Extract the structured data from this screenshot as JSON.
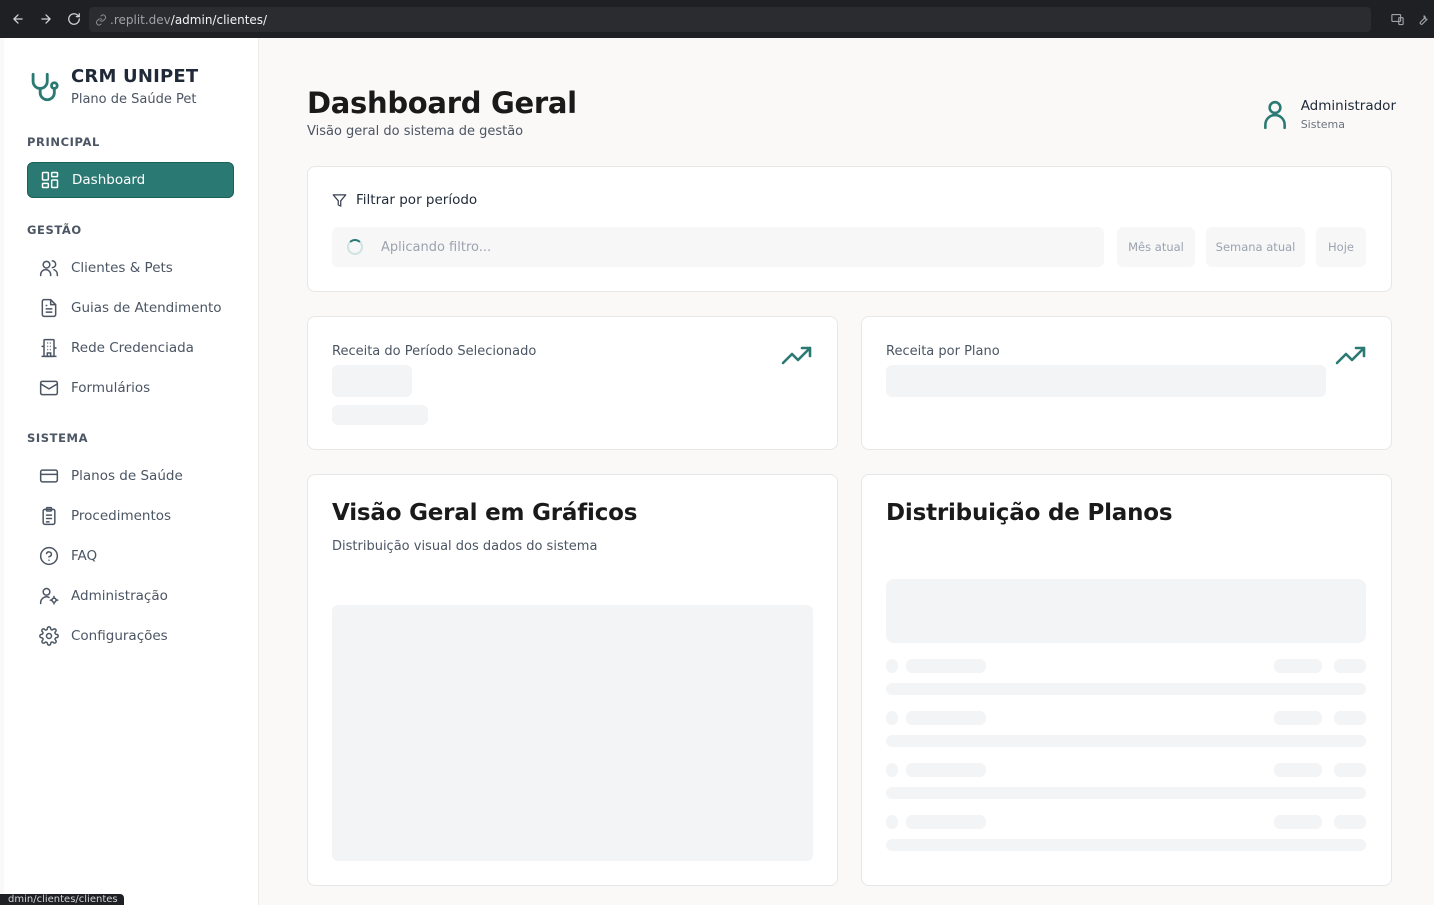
{
  "browser": {
    "url_host": ".replit.dev",
    "url_path": "/admin/clientes/",
    "status_link": "dmin/clientes/clientes"
  },
  "brand": {
    "title": "CRM UNIPET",
    "subtitle": "Plano de Saúde Pet"
  },
  "sidebar": {
    "sections": [
      {
        "label": "PRINCIPAL"
      },
      {
        "label": "GESTÃO"
      },
      {
        "label": "SISTEMA"
      }
    ],
    "items": [
      {
        "label": "Dashboard",
        "icon": "dashboard-icon",
        "active": true
      },
      {
        "label": "Clientes & Pets",
        "icon": "users-icon"
      },
      {
        "label": "Guias de Atendimento",
        "icon": "document-icon"
      },
      {
        "label": "Rede Credenciada",
        "icon": "building-icon"
      },
      {
        "label": "Formulários",
        "icon": "mail-icon"
      },
      {
        "label": "Planos de Saúde",
        "icon": "credit-card-icon"
      },
      {
        "label": "Procedimentos",
        "icon": "clipboard-icon"
      },
      {
        "label": "FAQ",
        "icon": "help-circle-icon"
      },
      {
        "label": "Administração",
        "icon": "user-cog-icon"
      },
      {
        "label": "Configurações",
        "icon": "gear-icon"
      }
    ]
  },
  "header": {
    "title": "Dashboard Geral",
    "subtitle": "Visão geral do sistema de gestão",
    "user_name": "Administrador",
    "user_role": "Sistema"
  },
  "filter": {
    "title": "Filtrar por período",
    "loading_text": "Aplicando filtro...",
    "chips": [
      "Mês atual",
      "Semana atual",
      "Hoje"
    ]
  },
  "stats": {
    "revenue_period_label": "Receita do Período Selecionado",
    "revenue_plan_label": "Receita por Plano"
  },
  "charts": {
    "overview_title": "Visão Geral em Gráficos",
    "overview_subtitle": "Distribuição visual dos dados do sistema",
    "plans_title": "Distribuição de Planos"
  },
  "colors": {
    "accent": "#2a7a73",
    "background": "#faf9f7",
    "skeleton": "#f3f4f6"
  }
}
